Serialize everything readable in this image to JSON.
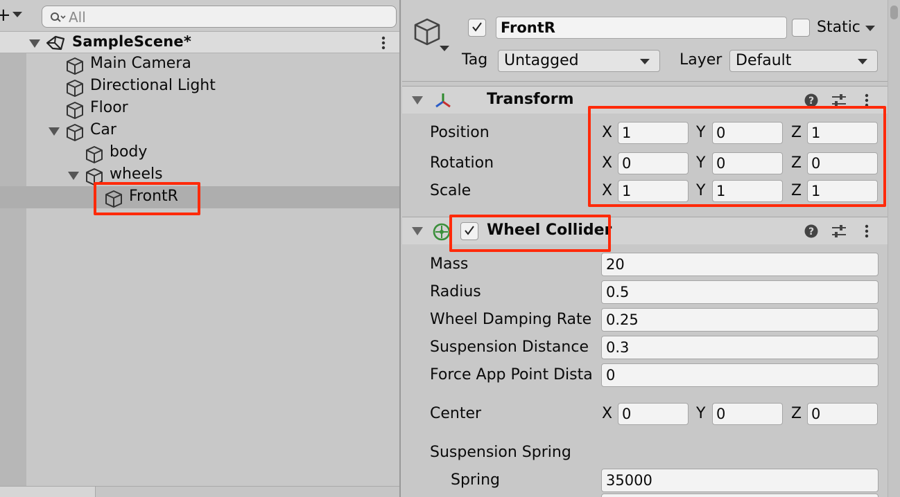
{
  "hierarchy": {
    "search_placeholder": "All",
    "scene_name": "SampleScene*",
    "items": [
      {
        "label": "Main Camera"
      },
      {
        "label": "Directional Light"
      },
      {
        "label": "Floor"
      },
      {
        "label": "Car"
      },
      {
        "label": "body"
      },
      {
        "label": "wheels"
      },
      {
        "label": "FrontR"
      }
    ]
  },
  "inspector": {
    "object_name": "FrontR",
    "active": true,
    "static_label": "Static",
    "tag_label": "Tag",
    "tag_value": "Untagged",
    "layer_label": "Layer",
    "layer_value": "Default",
    "transform": {
      "title": "Transform",
      "rows": [
        {
          "label": "Position",
          "x": "1",
          "y": "0",
          "z": "1"
        },
        {
          "label": "Rotation",
          "x": "0",
          "y": "0",
          "z": "0"
        },
        {
          "label": "Scale",
          "x": "1",
          "y": "1",
          "z": "1"
        }
      ]
    },
    "wheel_collider": {
      "title": "Wheel Collider",
      "enabled": true,
      "fields": [
        {
          "label": "Mass",
          "value": "20"
        },
        {
          "label": "Radius",
          "value": "0.5"
        },
        {
          "label": "Wheel Damping Rate",
          "value": "0.25"
        },
        {
          "label": "Suspension Distance",
          "value": "0.3"
        },
        {
          "label": "Force App Point Dista",
          "value": "0"
        }
      ],
      "center": {
        "label": "Center",
        "x": "0",
        "y": "0",
        "z": "0"
      },
      "suspension_spring": {
        "label": "Suspension Spring",
        "spring_label": "Spring",
        "spring_value": "35000"
      }
    }
  },
  "axis_labels": {
    "x": "X",
    "y": "Y",
    "z": "Z"
  },
  "colors": {
    "highlight": "#ff2a0a",
    "selected_row": "#aeaeae",
    "collider_icon": "#3b8f3b"
  }
}
